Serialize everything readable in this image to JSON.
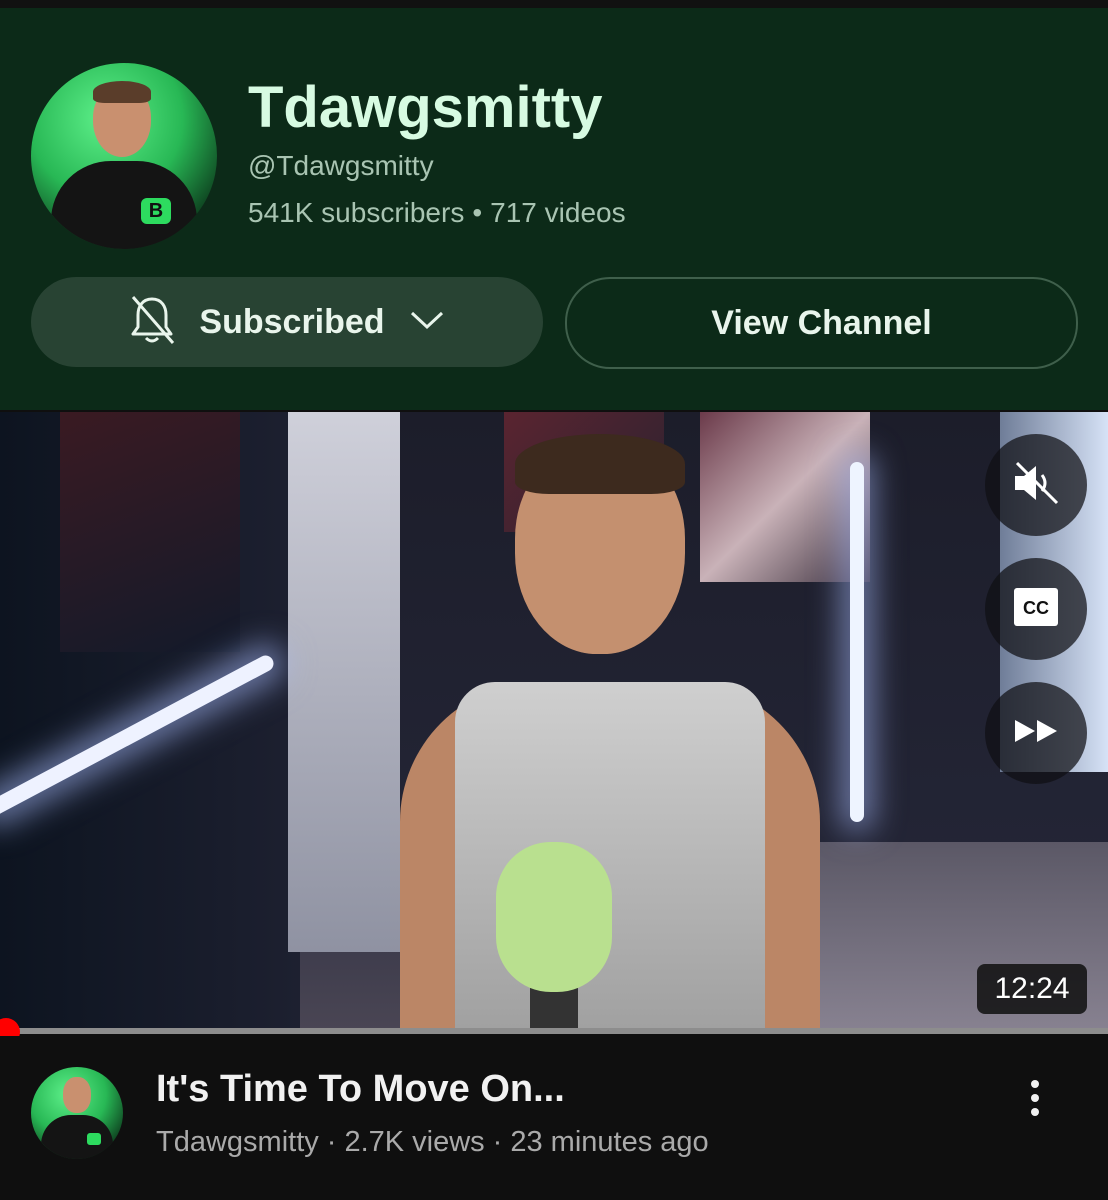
{
  "channel": {
    "name": "Tdawgsmitty",
    "handle": "@Tdawgsmitty",
    "subscribers": "541K subscribers",
    "videos": "717 videos",
    "separator": "•"
  },
  "actions": {
    "subscribed_label": "Subscribed",
    "view_channel_label": "View Channel"
  },
  "player": {
    "duration": "12:24",
    "progress_fraction": 0.005,
    "controls": [
      "mute-icon",
      "closed-captions-icon",
      "fast-forward-icon"
    ],
    "cc_text": "CC"
  },
  "video": {
    "title": "It's Time To Move On...",
    "channel": "Tdawgsmitty",
    "views": "2.7K views",
    "age": "23 minutes ago",
    "separator": "·"
  },
  "colors": {
    "header_bg": "#0c2a18",
    "accent_green": "#2ddb5f",
    "progress_red": "#ff0000"
  }
}
